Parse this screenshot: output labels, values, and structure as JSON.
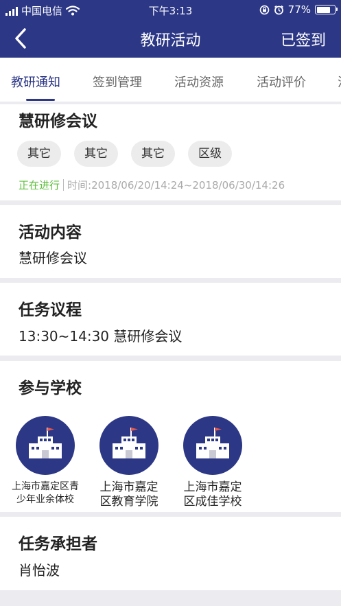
{
  "status_bar": {
    "carrier": "中国电信",
    "time": "下午3:13",
    "battery": "77%",
    "battery_level": 0.77
  },
  "nav": {
    "title": "教研活动",
    "right_action": "已签到"
  },
  "tabs": [
    {
      "label": "教研通知",
      "active": true
    },
    {
      "label": "签到管理",
      "active": false
    },
    {
      "label": "活动资源",
      "active": false
    },
    {
      "label": "活动评价",
      "active": false
    },
    {
      "label": "活",
      "active": false
    }
  ],
  "activity": {
    "title": "慧研修会议",
    "tags": [
      "其它",
      "其它",
      "其它",
      "区级"
    ],
    "status": "正在进行",
    "time": "时间:2018/06/20/14:24~2018/06/30/14:26"
  },
  "content_section": {
    "heading": "活动内容",
    "text": "慧研修会议"
  },
  "agenda_section": {
    "heading": "任务议程",
    "text": "13:30~14:30 慧研修会议"
  },
  "schools_section": {
    "heading": "参与学校",
    "schools": [
      {
        "line1": "上海市嘉定区青",
        "line2": "少年业余体校"
      },
      {
        "line1": "上海市嘉定",
        "line2": "区教育学院"
      },
      {
        "line1": "上海市嘉定",
        "line2": "区成佳学校"
      }
    ]
  },
  "owner_section": {
    "heading": "任务承担者",
    "text": "肖怡波"
  },
  "colors": {
    "primary": "#2c3786",
    "status_green": "#5cbf3a",
    "flag_red": "#e8584d"
  },
  "icons": [
    "back-chevron-icon",
    "wifi-icon",
    "orientation-lock-icon",
    "alarm-icon",
    "battery-icon",
    "school-building-icon"
  ]
}
